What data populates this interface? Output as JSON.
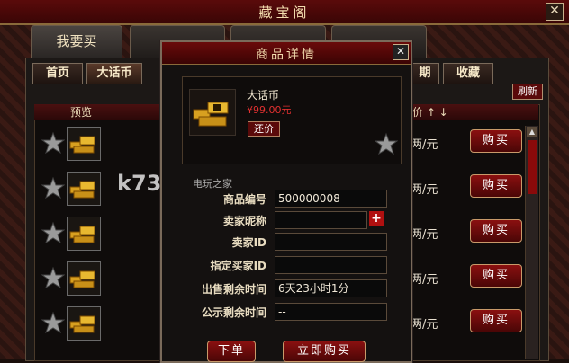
{
  "window": {
    "title": "藏宝阁",
    "close_glyph": "✕"
  },
  "main_tabs": [
    "我要买",
    "",
    "",
    ""
  ],
  "sub_tabs": [
    "首页",
    "大话币",
    "期",
    "收藏"
  ],
  "refresh_label": "刷新",
  "list": {
    "col_preview": "预览",
    "col_price": "价 ↑ ↓",
    "rows": [
      {
        "price": "两/元",
        "buy": "购买"
      },
      {
        "price": "两/元",
        "buy": "购买"
      },
      {
        "price": "两/元",
        "buy": "购买"
      },
      {
        "price": "两/元",
        "buy": "购买"
      },
      {
        "price": "两/元",
        "buy": "购买"
      }
    ]
  },
  "dialog": {
    "title": "商品详情",
    "item_name": "大话币",
    "item_price": "¥99.00元",
    "haggle_label": "还价",
    "fields": [
      {
        "label": "商品编号",
        "value": "500000008"
      },
      {
        "label": "卖家昵称",
        "value": ""
      },
      {
        "label": "卖家ID",
        "value": ""
      },
      {
        "label": "指定买家ID",
        "value": ""
      },
      {
        "label": "出售剩余时间",
        "value": "6天23小时1分"
      },
      {
        "label": "公示剩余时间",
        "value": "--"
      }
    ],
    "order_button": "下单",
    "buy_now_button": "立即购买"
  },
  "watermark": {
    "text": "k73",
    "sub": "电玩之家"
  },
  "colors": {
    "accent_red": "#8a1010",
    "gold_text": "#f3dcae",
    "price_red": "#e03030"
  }
}
